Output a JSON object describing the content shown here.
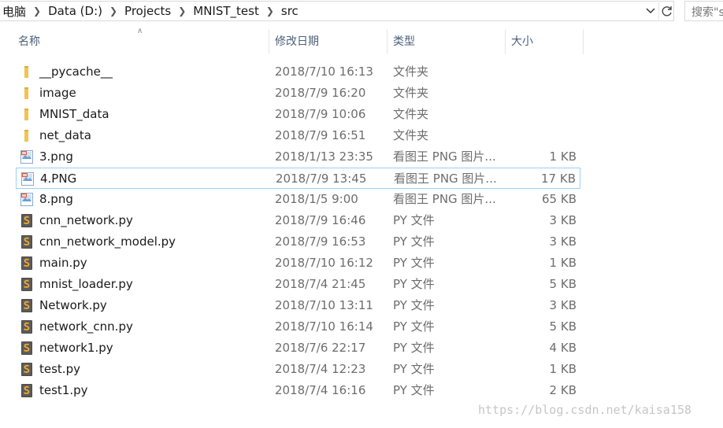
{
  "address": {
    "crumbs": [
      "电脑",
      "Data (D:)",
      "Projects",
      "MNIST_test",
      "src"
    ]
  },
  "search": {
    "placeholder": "搜索\"s"
  },
  "columns": {
    "name": "名称",
    "date": "修改日期",
    "type": "类型",
    "size": "大小"
  },
  "files": [
    {
      "name": "__pycache__",
      "date": "2018/7/10 16:13",
      "type": "文件夹",
      "size": "",
      "icon": "folder-icon"
    },
    {
      "name": "image",
      "date": "2018/7/9 16:20",
      "type": "文件夹",
      "size": "",
      "icon": "folder-icon"
    },
    {
      "name": "MNIST_data",
      "date": "2018/7/9 10:06",
      "type": "文件夹",
      "size": "",
      "icon": "folder-icon"
    },
    {
      "name": "net_data",
      "date": "2018/7/9 16:51",
      "type": "文件夹",
      "size": "",
      "icon": "folder-icon"
    },
    {
      "name": "3.png",
      "date": "2018/1/13 23:35",
      "type": "看图王 PNG 图片...",
      "size": "1 KB",
      "icon": "image-file-icon"
    },
    {
      "name": "4.PNG",
      "date": "2018/7/9 13:45",
      "type": "看图王 PNG 图片...",
      "size": "17 KB",
      "icon": "image-file-icon",
      "selected": true
    },
    {
      "name": "8.png",
      "date": "2018/1/5 9:00",
      "type": "看图王 PNG 图片...",
      "size": "65 KB",
      "icon": "image-file-icon"
    },
    {
      "name": "cnn_network.py",
      "date": "2018/7/9 16:46",
      "type": "PY 文件",
      "size": "3 KB",
      "icon": "python-file-icon"
    },
    {
      "name": "cnn_network_model.py",
      "date": "2018/7/9 16:53",
      "type": "PY 文件",
      "size": "3 KB",
      "icon": "python-file-icon"
    },
    {
      "name": "main.py",
      "date": "2018/7/10 16:12",
      "type": "PY 文件",
      "size": "1 KB",
      "icon": "python-file-icon"
    },
    {
      "name": "mnist_loader.py",
      "date": "2018/7/4 21:45",
      "type": "PY 文件",
      "size": "5 KB",
      "icon": "python-file-icon"
    },
    {
      "name": "Network.py",
      "date": "2018/7/10 13:11",
      "type": "PY 文件",
      "size": "3 KB",
      "icon": "python-file-icon"
    },
    {
      "name": "network_cnn.py",
      "date": "2018/7/10 16:14",
      "type": "PY 文件",
      "size": "5 KB",
      "icon": "python-file-icon"
    },
    {
      "name": "network1.py",
      "date": "2018/7/6 22:17",
      "type": "PY 文件",
      "size": "4 KB",
      "icon": "python-file-icon"
    },
    {
      "name": "test.py",
      "date": "2018/7/4 12:23",
      "type": "PY 文件",
      "size": "1 KB",
      "icon": "python-file-icon"
    },
    {
      "name": "test1.py",
      "date": "2018/7/4 16:16",
      "type": "PY 文件",
      "size": "2 KB",
      "icon": "python-file-icon"
    }
  ],
  "watermark": "https://blog.csdn.net/kaisa158",
  "colors": {
    "header_text": "#4c607a",
    "selected_border": "#99d1ff",
    "folder": "#f2c350",
    "python_icon": "#4a4a4a"
  }
}
